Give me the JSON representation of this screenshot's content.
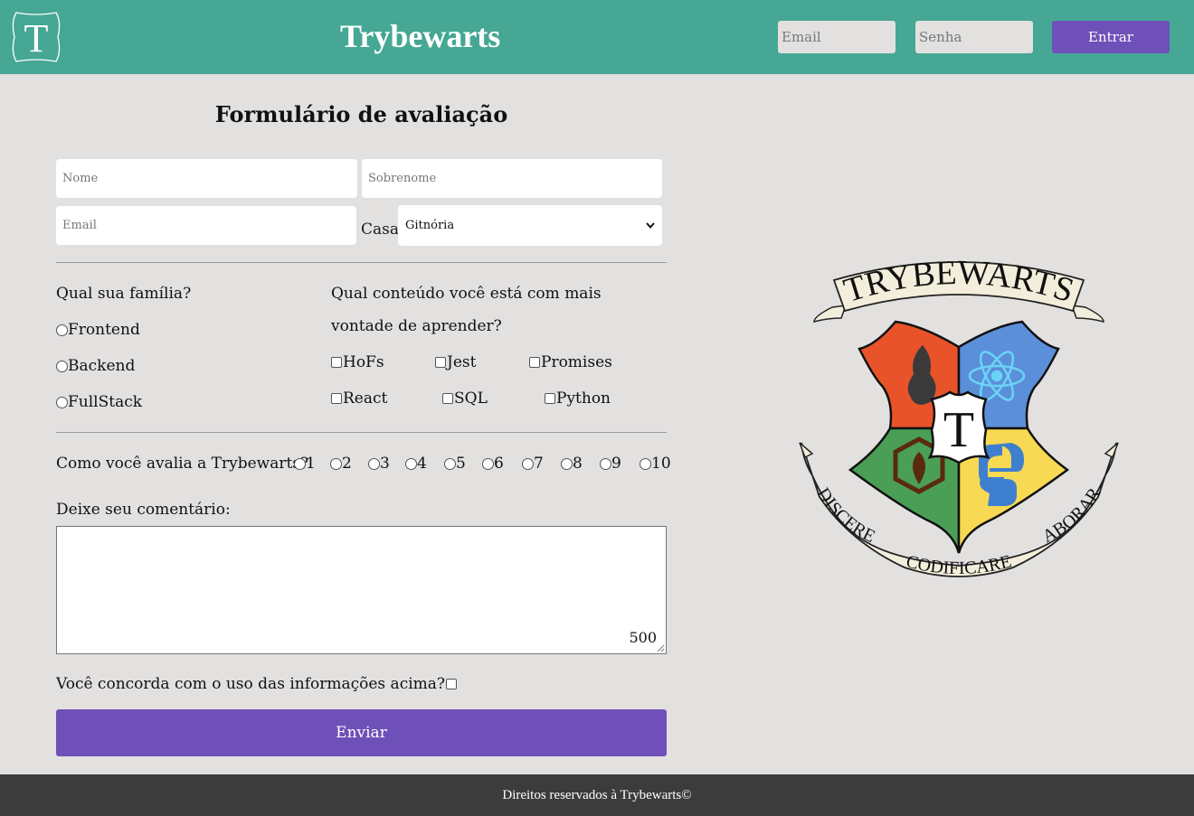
{
  "header": {
    "logo_letter": "T",
    "title": "Trybewarts",
    "email_placeholder": "Email",
    "password_placeholder": "Senha",
    "login_button": "Entrar"
  },
  "form": {
    "title": "Formulário de avaliação",
    "name_placeholder": "Nome",
    "lastname_placeholder": "Sobrenome",
    "email_placeholder": "Email",
    "house_label": "Casa",
    "house_selected": "Gitnória",
    "family": {
      "question": "Qual sua família?",
      "options": [
        "Frontend",
        "Backend",
        "FullStack"
      ]
    },
    "content": {
      "question_line1": "Qual conteúdo você está com mais",
      "question_line2": "vontade de aprender?",
      "options": [
        "HoFs",
        "Jest",
        "Promises",
        "React",
        "SQL",
        "Python"
      ]
    },
    "rating": {
      "question": "Como você avalia a Trybewarts?",
      "options": [
        "1",
        "2",
        "3",
        "4",
        "5",
        "6",
        "7",
        "8",
        "9",
        "10"
      ]
    },
    "comment_label": "Deixe seu comentário:",
    "char_counter": "500",
    "agreement_label": "Você concorda com o uso das informações acima?",
    "submit_button": "Enviar"
  },
  "crest": {
    "banner_top": "TRYBEWARTS",
    "center_letter": "T",
    "motto_left": "DISCERE",
    "motto_center": "CODIFICARE",
    "motto_right": "LABORARE",
    "colors": {
      "red": "#e8532a",
      "blue": "#5b8fd9",
      "green": "#4a9e55",
      "yellow": "#f7d953",
      "ribbon": "#f3eedb"
    }
  },
  "footer": {
    "text": "Direitos reservados à Trybewarts©"
  },
  "colors": {
    "header_bg": "#45a794",
    "page_bg": "#e3e0e0",
    "button_purple": "#6f50b8",
    "footer_bg": "#3c3c3c"
  }
}
